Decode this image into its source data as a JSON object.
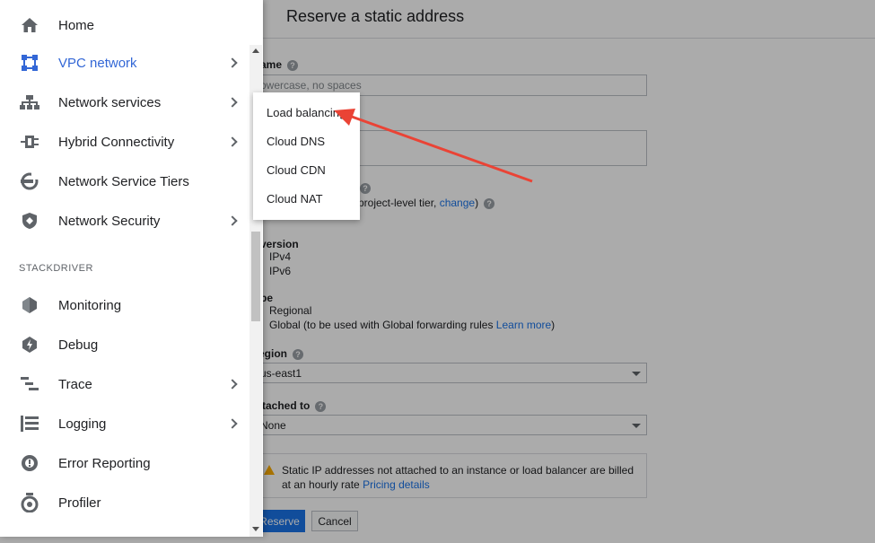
{
  "form": {
    "title": "Reserve a static address",
    "name_label": "ame",
    "name_placeholder": "owercase, no spaces",
    "tier_text_pre": "project-level tier, ",
    "tier_change": "change",
    "tier_text_post": ")",
    "ip_version_label": "version",
    "ipv4": "IPv4",
    "ipv6": "IPv6",
    "type_label": "pe",
    "regional": "Regional",
    "global_text": "Global (to be used with Global forwarding rules ",
    "learn_more": "Learn more",
    "global_close": ")",
    "region_label": "egion",
    "region_value": "us-east1",
    "attached_label": "ttached to",
    "attached_value": "None",
    "warning_text": "Static IP addresses not attached to an instance or load balancer are billed at an hourly rate ",
    "pricing_link": "Pricing details",
    "reserve_button": "Reserve",
    "cancel_button": "Cancel"
  },
  "sidebar": {
    "items": [
      {
        "label": "Home",
        "icon": "home-icon",
        "has_submenu": false
      },
      {
        "label": "VPC network",
        "icon": "vpc-network-icon",
        "has_submenu": true,
        "active": true
      },
      {
        "label": "Network services",
        "icon": "network-services-icon",
        "has_submenu": true
      },
      {
        "label": "Hybrid Connectivity",
        "icon": "hybrid-connectivity-icon",
        "has_submenu": true
      },
      {
        "label": "Network Service Tiers",
        "icon": "network-service-tiers-icon",
        "has_submenu": false
      },
      {
        "label": "Network Security",
        "icon": "network-security-icon",
        "has_submenu": true
      }
    ],
    "section": "STACKDRIVER",
    "stackdriver_items": [
      {
        "label": "Monitoring",
        "icon": "monitoring-icon",
        "has_submenu": false
      },
      {
        "label": "Debug",
        "icon": "debug-icon",
        "has_submenu": false
      },
      {
        "label": "Trace",
        "icon": "trace-icon",
        "has_submenu": true
      },
      {
        "label": "Logging",
        "icon": "logging-icon",
        "has_submenu": true
      },
      {
        "label": "Error Reporting",
        "icon": "error-reporting-icon",
        "has_submenu": false
      },
      {
        "label": "Profiler",
        "icon": "profiler-icon",
        "has_submenu": false
      }
    ]
  },
  "flyout": {
    "items": [
      "Load balancing",
      "Cloud DNS",
      "Cloud CDN",
      "Cloud NAT"
    ]
  },
  "colors": {
    "accent": "#3367d6",
    "annotation_arrow": "#ea4335",
    "primary_button": "#1a73e8"
  }
}
